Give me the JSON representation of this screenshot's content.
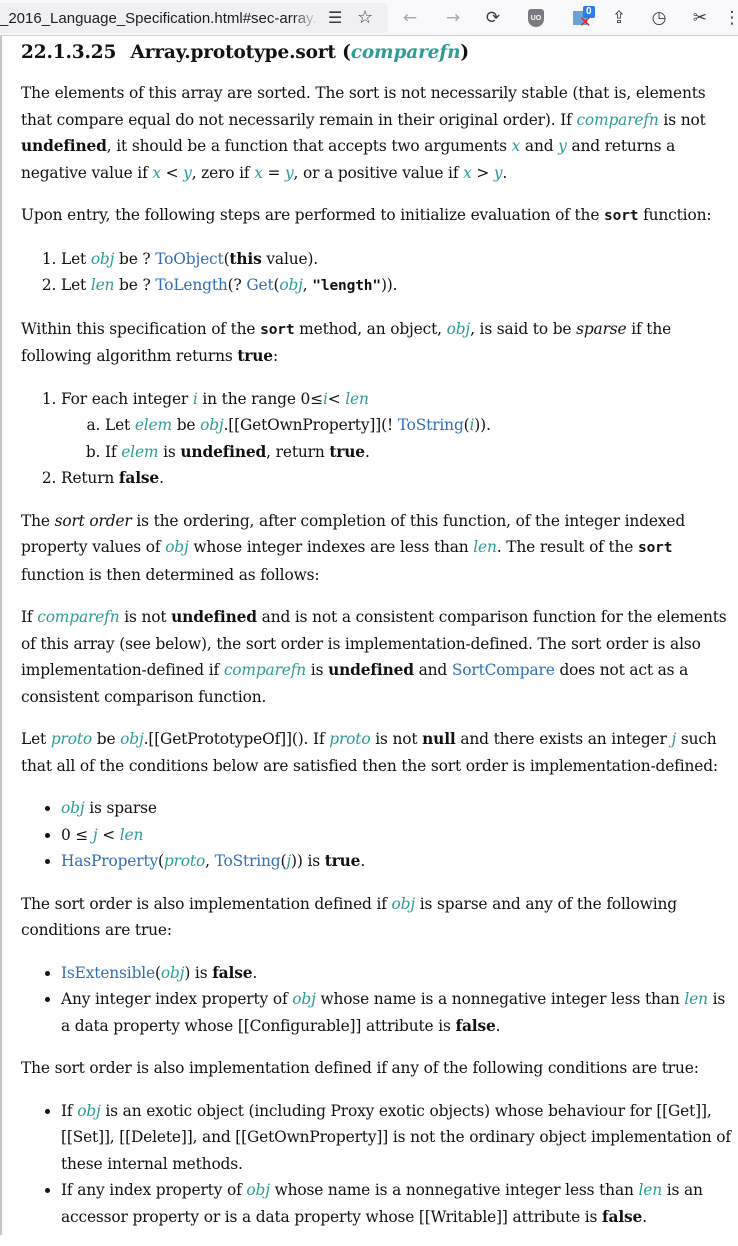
{
  "browser": {
    "url": "_2016_Language_Specification.html#sec-array.prototype.sort",
    "reader_icon": "reader-view-icon",
    "bookmark_icon": "star-icon",
    "back_icon": "arrow-left-icon",
    "forward_icon": "arrow-right-icon",
    "reload_icon": "reload-icon",
    "ublock_label": "UO",
    "extension_badge": "0",
    "icons": {
      "back": "←",
      "forward": "→",
      "reload": "⟳",
      "reader": "☰",
      "star": "☆",
      "save": "⇪",
      "history": "◷",
      "screenshot": "✂",
      "menu": "⋮"
    }
  },
  "section": {
    "number": "22.1.3.25",
    "title": "Array.prototype.sort (",
    "param": "comparefn",
    "close": ")"
  },
  "p1": {
    "t1": "The elements of this array are sorted. The sort is not necessarily stable (that is, elements that compare equal do not necessarily remain in their original order). If ",
    "comparefn": "comparefn",
    "t2": " is not ",
    "undefined": "undefined",
    "t3": ", it should be a function that accepts two arguments ",
    "x": "x",
    "t4": " and ",
    "y": "y",
    "t5": " and returns a negative value if ",
    "t6": " < ",
    "t7": ", zero if ",
    "t8": " = ",
    "t9": ", or a positive value if ",
    "t10": " > ",
    "t11": "."
  },
  "p2": {
    "t1": "Upon entry, the following steps are performed to initialize evaluation of the ",
    "sort": "sort",
    "t2": " function:"
  },
  "steps1": [
    {
      "let": "Let ",
      "var": "obj",
      "be": " be ? ",
      "fn": "ToObject",
      "open": "(",
      "this": "this",
      "rest": " value)."
    },
    {
      "let": "Let ",
      "var": "len",
      "be": " be ? ",
      "fn": "ToLength",
      "mid": "(? ",
      "fn2": "Get",
      "open": "(",
      "obj": "obj",
      "comma": ", ",
      "str": "\"length\"",
      "close": "))."
    }
  ],
  "p3": {
    "t1": "Within this specification of the ",
    "sort": "sort",
    "t2": " method, an object, ",
    "obj": "obj",
    "t3": ", is said to be ",
    "sparse": "sparse",
    "t4": " if the following algorithm returns ",
    "true": "true",
    "t5": ":"
  },
  "steps2": {
    "s1": {
      "t1": "For each integer ",
      "i": "i",
      "t2": " in the range 0≤",
      "t3": "< ",
      "len": "len"
    },
    "s1a": {
      "t1": "Let ",
      "elem": "elem",
      "t2": " be ",
      "obj": "obj",
      "t3": ".[[GetOwnProperty]](! ",
      "fn": "ToString",
      "open": "(",
      "i": "i",
      "close": "))."
    },
    "s1b": {
      "t1": "If ",
      "elem": "elem",
      "t2": " is ",
      "undefined": "undefined",
      "t3": ", return ",
      "true": "true",
      "t4": "."
    },
    "s2": {
      "t1": "Return ",
      "false": "false",
      "t2": "."
    }
  },
  "p4": {
    "t1": "The ",
    "sortorder": "sort order",
    "t2": " is the ordering, after completion of this function, of the integer indexed property values of ",
    "obj": "obj",
    "t3": " whose integer indexes are less than ",
    "len": "len",
    "t4": ". The result of the ",
    "sort": "sort",
    "t5": " function is then determined as follows:"
  },
  "p5": {
    "t1": "If ",
    "comparefn": "comparefn",
    "t2": " is not ",
    "undefined": "undefined",
    "t3": " and is not a consistent comparison function for the elements of this array (see below), the sort order is implementation-defined. The sort order is also implementation-defined if ",
    "t4": " is ",
    "t5": " and ",
    "sortcompare": "SortCompare",
    "t6": " does not act as a consistent comparison function."
  },
  "p6": {
    "t1": "Let ",
    "proto": "proto",
    "t2": " be ",
    "obj": "obj",
    "t3": ".[[GetPrototypeOf]](). If ",
    "t4": " is not ",
    "null": "null",
    "t5": " and there exists an integer ",
    "j": "j",
    "t6": " such that all of the conditions below are satisfied then the sort order is implementation-defined:"
  },
  "list1": {
    "b1": {
      "obj": "obj",
      "t1": " is sparse"
    },
    "b2": {
      "t1": "0 ≤ ",
      "j": "j",
      "t2": " < ",
      "len": "len"
    },
    "b3": {
      "fn": "HasProperty",
      "open": "(",
      "proto": "proto",
      "comma": ", ",
      "fn2": "ToString",
      "open2": "(",
      "j": "j",
      "close": "))",
      "t1": " is ",
      "true": "true",
      "t2": "."
    }
  },
  "p7": {
    "t1": "The sort order is also implementation defined if ",
    "obj": "obj",
    "t2": " is sparse and any of the following conditions are true:"
  },
  "list2": {
    "b1": {
      "fn": "IsExtensible",
      "open": "(",
      "obj": "obj",
      "close": ")",
      "t1": " is ",
      "false": "false",
      "t2": "."
    },
    "b2": {
      "t1": "Any integer index property of ",
      "obj": "obj",
      "t2": " whose name is a nonnegative integer less than ",
      "len": "len",
      "t3": " is a data property whose [[Configurable]] attribute is ",
      "false": "false",
      "t4": "."
    }
  },
  "p8": {
    "t1": "The sort order is also implementation defined if any of the following conditions are true:"
  },
  "list3": {
    "b1": {
      "t1": "If ",
      "obj": "obj",
      "t2": " is an exotic object (including Proxy exotic objects) whose behaviour for [[Get]], [[Set]], [[Delete]], and [[GetOwnProperty]] is not the ordinary object implementation of these internal methods."
    },
    "b2": {
      "t1": "If any index property of ",
      "obj": "obj",
      "t2": " whose name is a nonnegative integer less than ",
      "len": "len",
      "t3": " is an accessor property or is a data property whose [[Writable]] attribute is ",
      "false": "false",
      "t4": "."
    }
  }
}
